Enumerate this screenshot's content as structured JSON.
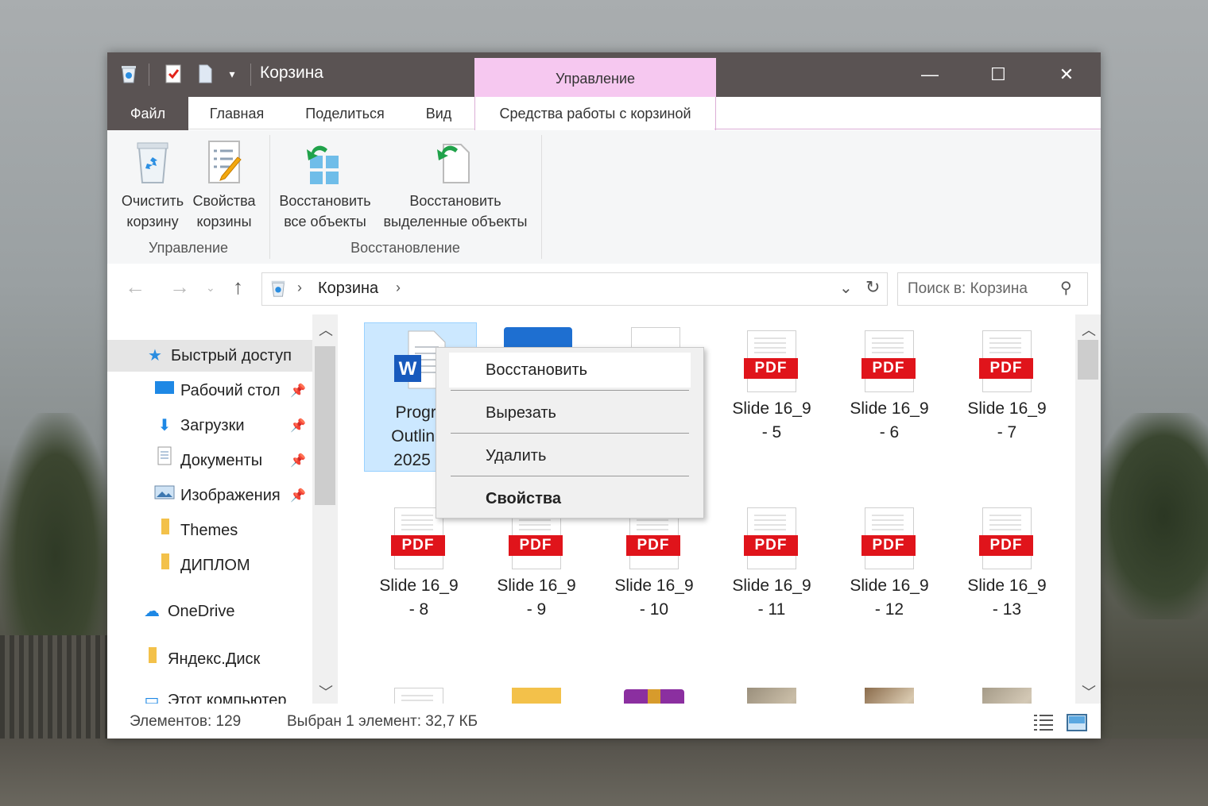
{
  "window": {
    "title": "Корзина",
    "contextual_tab_header": "Управление"
  },
  "tabs": [
    {
      "label": "Файл"
    },
    {
      "label": "Главная"
    },
    {
      "label": "Поделиться"
    },
    {
      "label": "Вид"
    },
    {
      "label": "Средства работы с корзиной"
    }
  ],
  "ribbon": {
    "groups": [
      {
        "label": "Управление",
        "buttons": [
          {
            "line1": "Очистить",
            "line2": "корзину",
            "icon": "recycle-bin-icon"
          },
          {
            "line1": "Свойства",
            "line2": "корзины",
            "icon": "properties-icon"
          }
        ]
      },
      {
        "label": "Восстановление",
        "buttons": [
          {
            "line1": "Восстановить",
            "line2": "все объекты",
            "icon": "restore-all-icon"
          },
          {
            "line1": "Восстановить",
            "line2": "выделенные объекты",
            "icon": "restore-selected-icon"
          }
        ]
      }
    ]
  },
  "address": {
    "crumb": "Корзина",
    "search_placeholder": "Поиск в: Корзина"
  },
  "nav_pane": {
    "quick_access": "Быстрый доступ",
    "items": [
      {
        "label": "Рабочий стол",
        "pinned": true
      },
      {
        "label": "Загрузки",
        "pinned": true
      },
      {
        "label": "Документы",
        "pinned": true
      },
      {
        "label": "Изображения",
        "pinned": true
      },
      {
        "label": "Themes",
        "pinned": false
      },
      {
        "label": "ДИПЛОМ",
        "pinned": false
      }
    ],
    "onedrive": "OneDrive",
    "yandex": "Яндекс.Диск",
    "this_pc": "Этот компьютер"
  },
  "files": {
    "selected": {
      "line1": "Progra",
      "line2": "Outline-",
      "line3": "2025 H"
    },
    "pdf_badge": "PDF",
    "row1": [
      {
        "line1": "Slide 16_9",
        "line2": "- 5"
      },
      {
        "line1": "Slide 16_9",
        "line2": "- 6"
      },
      {
        "line1": "Slide 16_9",
        "line2": "- 7"
      }
    ],
    "row2": [
      {
        "line1": "Slide 16_9",
        "line2": "- 8"
      },
      {
        "line1": "Slide 16_9",
        "line2": "- 9"
      },
      {
        "line1": "Slide 16_9",
        "line2": "- 10"
      },
      {
        "line1": "Slide 16_9",
        "line2": "- 11"
      },
      {
        "line1": "Slide 16_9",
        "line2": "- 12"
      },
      {
        "line1": "Slide 16_9",
        "line2": "- 13"
      }
    ]
  },
  "context_menu": {
    "items": [
      "Восстановить",
      "Вырезать",
      "Удалить",
      "Свойства"
    ]
  },
  "status": {
    "count": "Элементов: 129",
    "selection": "Выбран 1 элемент: 32,7 КБ"
  },
  "colors": {
    "titlebar": "#5a5353",
    "contextual_tab": "#f6c8f0",
    "selection": "#cce8ff",
    "pdf_red": "#e0141b"
  }
}
